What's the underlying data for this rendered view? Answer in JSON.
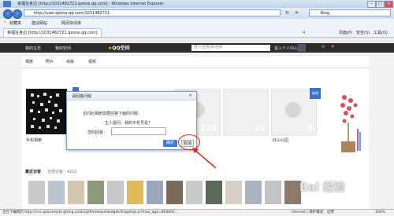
{
  "window": {
    "title": "幸福在身边 [http://1031482721.qzone.qq.com] - Windows Internet Explorer",
    "url": "http://user.qzone.qq.com/1031482721",
    "search_text": "Bing"
  },
  "favorites_bar": {
    "label": "收藏夹",
    "items": [
      "建议网站",
      "网页快讯库"
    ]
  },
  "tab": {
    "label": "幸福在身边 [http://1031482721.qzone.qq.com]"
  },
  "command_bar": {
    "items": [
      "页面(P)",
      "安全(S)",
      "工具(O)"
    ]
  },
  "qq_bar": {
    "left_items": [
      "我的主页",
      "我的空间"
    ],
    "logo": "QQ空间",
    "search_placeholder": "用户/应用/群/相册",
    "personal_center": "进入个人中心"
  },
  "sub_nav": {
    "items": [
      "相册",
      "照片",
      "高级",
      "视频"
    ]
  },
  "albums": [
    {
      "name": "手机相册"
    },
    {
      "name": "红山公园",
      "badge": "新建"
    }
  ],
  "recent_visitors": {
    "label": "最近访客",
    "count_text": "全部访客：4202"
  },
  "dialog": {
    "title": "请回答问题",
    "question": "访问此相册需要回答下面的问题：",
    "question_detail": "主人提问：我的手机号是？",
    "answer_label": "您的回答：",
    "answer_value": "",
    "ok_label": "确定",
    "cancel_label": "取消"
  },
  "status": {
    "left": "正在下载网页 http://cnc.qzonestyle.gtimg.cn/ac/qzfl/release/widget/dragdrop.js?max_age=864001...",
    "zone": "Internet | 保护模式：启用",
    "zoom": "100%"
  },
  "colors": {
    "accent": "#3d7bd0",
    "highlight_circle": "#e02020"
  }
}
